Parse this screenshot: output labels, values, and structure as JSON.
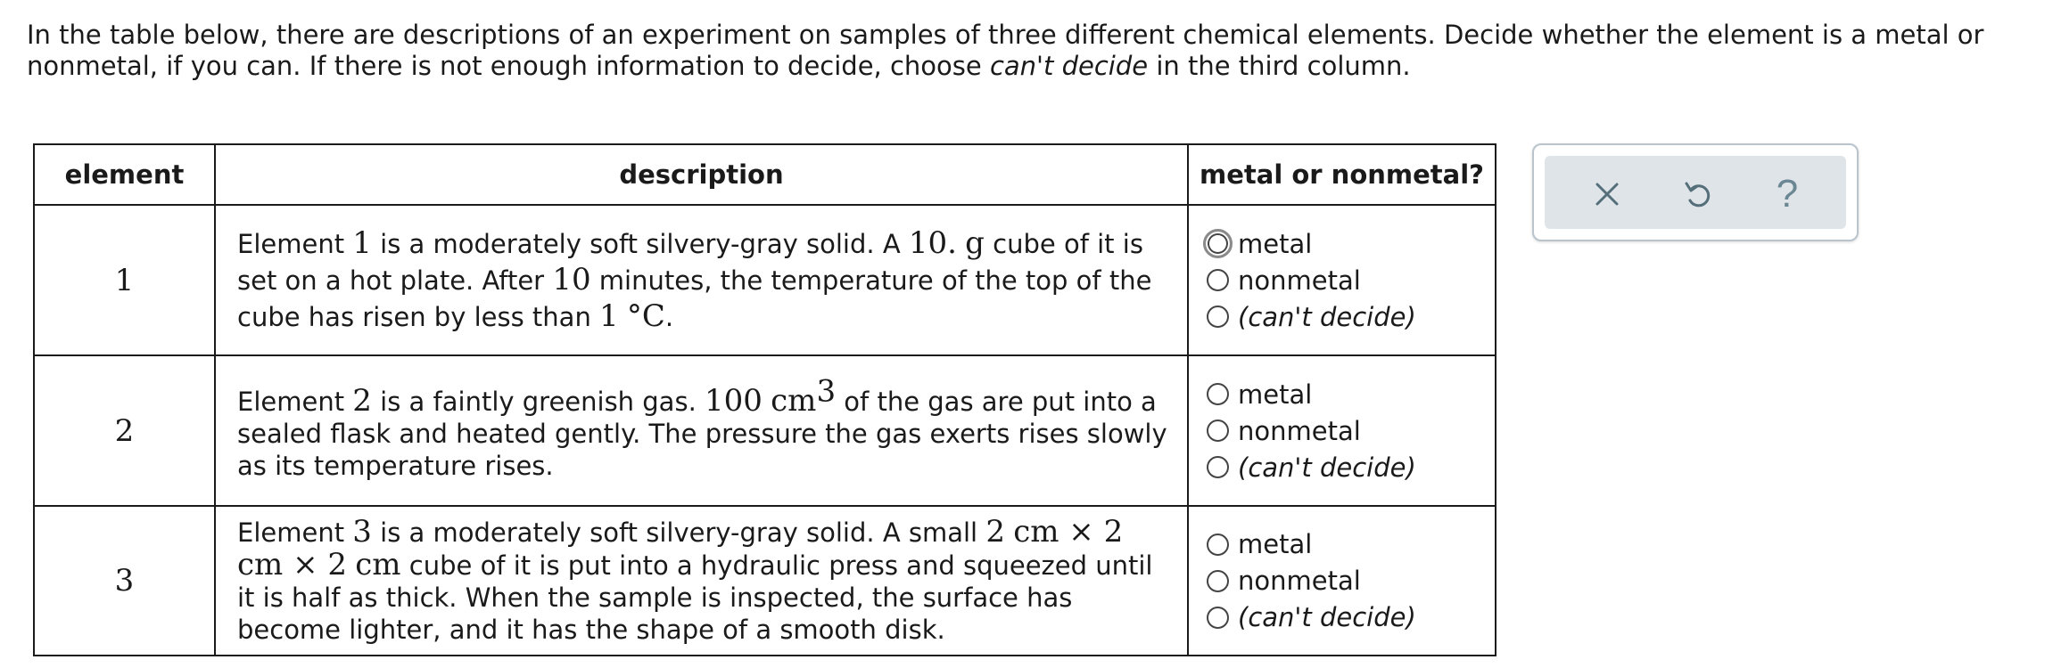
{
  "intro": {
    "part1": "In the table below, there are descriptions of an experiment on samples of three different chemical elements. Decide whether the element is a metal or nonmetal, if you can. If there is not enough information to decide, choose ",
    "emph": "can't decide",
    "part2": " in the third column."
  },
  "table": {
    "headers": [
      "element",
      "description",
      "metal or nonmetal?"
    ],
    "options": [
      "metal",
      "nonmetal",
      "(can't decide)"
    ],
    "rows": [
      {
        "num": "1",
        "desc": [
          "Element ",
          "1",
          " is a moderately soft silvery-gray solid. A ",
          "10.",
          " ",
          "g",
          " cube of it is set on a hot plate. After ",
          "10",
          " minutes, the temperature of the top of the cube has risen by less than ",
          "1",
          " ",
          "°C",
          "."
        ]
      },
      {
        "num": "2",
        "desc": [
          "Element ",
          "2",
          " is a faintly greenish gas. ",
          "100",
          " ",
          "cm",
          "3",
          " of the gas are put into a sealed flask and heated gently. The pressure the gas exerts rises slowly as its temperature rises."
        ]
      },
      {
        "num": "3",
        "desc": [
          "Element ",
          "3",
          " is a moderately soft silvery-gray solid. A small ",
          "2",
          " ",
          "cm",
          " × ",
          "2",
          " ",
          "cm",
          " × ",
          "2",
          " ",
          "cm",
          " cube of it is put into a hydraulic press and squeezed until it is half as thick. When the sample is inspected, the surface has become lighter, and it has the shape of a smooth disk."
        ]
      }
    ]
  },
  "toolbar": {
    "close_icon": "close-icon",
    "undo_icon": "undo-icon",
    "help_label": "?"
  },
  "colors": {
    "toolbar_bg": "#dfe4e8",
    "toolbar_border": "#b9c4cc",
    "icon": "#546e7a"
  }
}
